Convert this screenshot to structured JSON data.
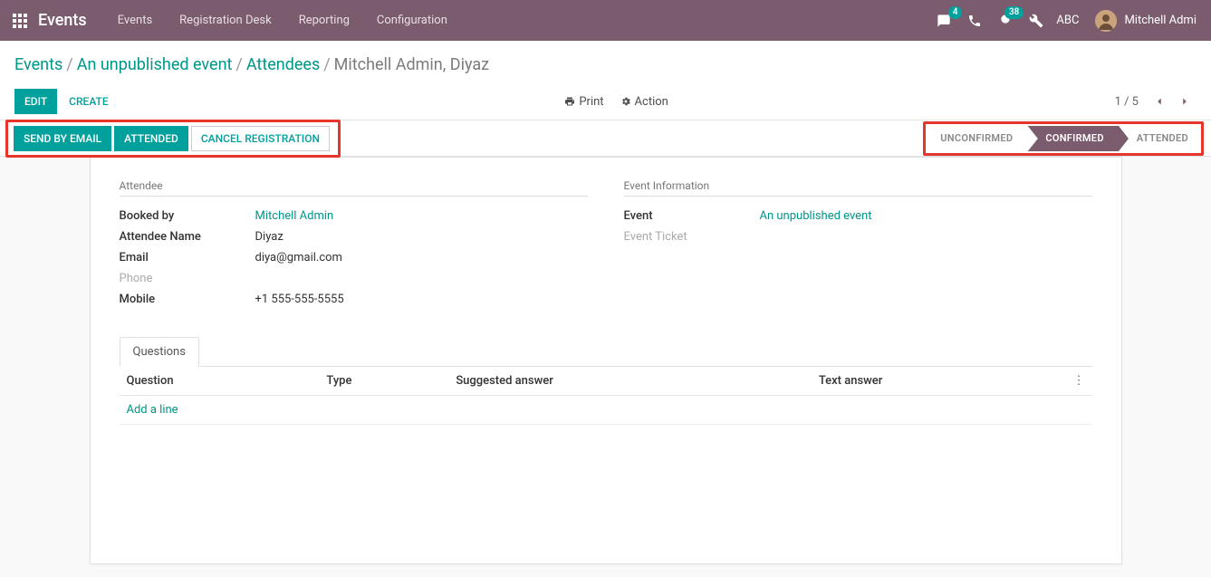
{
  "nav": {
    "title": "Events",
    "items": [
      "Events",
      "Registration Desk",
      "Reporting",
      "Configuration"
    ],
    "chat_badge": "4",
    "activity_badge": "38",
    "company": "ABC",
    "user": "Mitchell Admi"
  },
  "breadcrumb": {
    "root": "Events",
    "event": "An unpublished event",
    "attendees": "Attendees",
    "current": "Mitchell Admin, Diyaz"
  },
  "buttons": {
    "edit": "EDIT",
    "create": "CREATE",
    "print": "Print",
    "action": "Action",
    "send_email": "SEND BY EMAIL",
    "attended": "ATTENDED",
    "cancel": "CANCEL REGISTRATION"
  },
  "pager": {
    "text": "1 / 5"
  },
  "status": {
    "unconfirmed": "UNCONFIRMED",
    "confirmed": "CONFIRMED",
    "attended": "ATTENDED"
  },
  "attendee": {
    "group": "Attendee",
    "booked_by_label": "Booked by",
    "booked_by": "Mitchell Admin",
    "name_label": "Attendee Name",
    "name": "Diyaz",
    "email_label": "Email",
    "email": "diya@gmail.com",
    "phone_label": "Phone",
    "mobile_label": "Mobile",
    "mobile": "+1 555-555-5555"
  },
  "event_info": {
    "group": "Event Information",
    "event_label": "Event",
    "event": "An unpublished event",
    "ticket_label": "Event Ticket"
  },
  "questions": {
    "tab": "Questions",
    "cols": {
      "q": "Question",
      "type": "Type",
      "sugg": "Suggested answer",
      "text": "Text answer"
    },
    "add": "Add a line"
  }
}
